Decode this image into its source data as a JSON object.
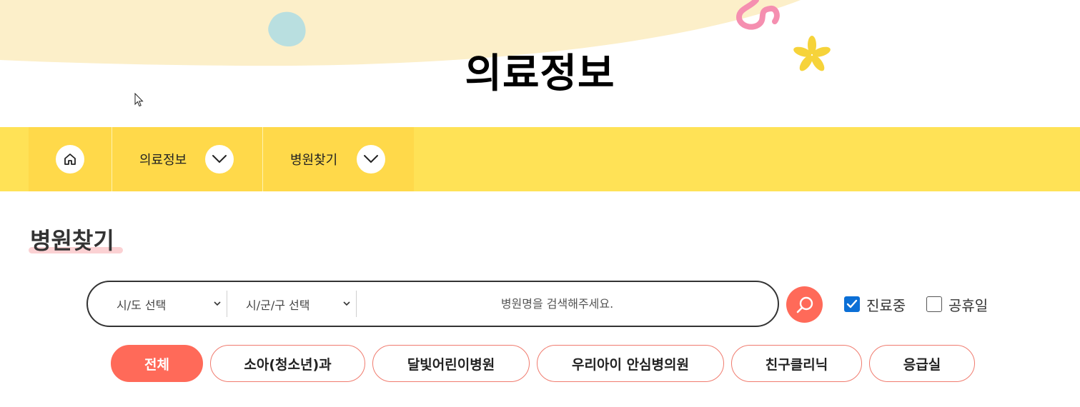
{
  "page": {
    "title": "의료정보"
  },
  "nav": {
    "home_icon": "home-icon",
    "items": [
      {
        "label": "의료정보",
        "icon": "chevron-down-icon"
      },
      {
        "label": "병원찾기",
        "icon": "chevron-down-icon"
      }
    ]
  },
  "section": {
    "title": "병원찾기"
  },
  "search": {
    "city_select": "시/도 선택",
    "district_select": "시/군/구 선택",
    "placeholder": "병원명을 검색해주세요.",
    "button_icon": "search-icon"
  },
  "filters": {
    "open_now": {
      "label": "진료중",
      "checked": true
    },
    "holiday": {
      "label": "공휴일",
      "checked": false
    }
  },
  "categories": [
    {
      "label": "전체",
      "active": true
    },
    {
      "label": "소아(청소년)과",
      "active": false
    },
    {
      "label": "달빛어린이병원",
      "active": false
    },
    {
      "label": "우리아이 안심병의원",
      "active": false
    },
    {
      "label": "친구클리닉",
      "active": false
    },
    {
      "label": "응급실",
      "active": false
    }
  ],
  "colors": {
    "accent": "#ff6a59",
    "nav_bg": "#ffe256",
    "hero_wave": "#fcefc9",
    "checkbox": "#0b6fd6"
  }
}
